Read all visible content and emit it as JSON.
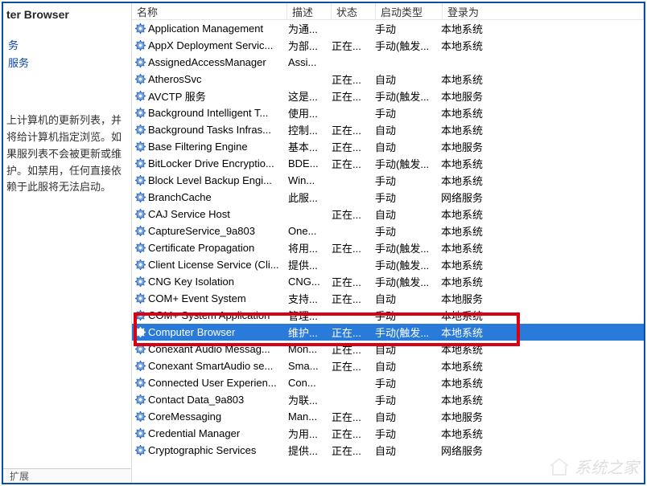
{
  "sidebar": {
    "title_partial": "ter Browser",
    "link1": "务",
    "link2": "服务",
    "desc_partial": "上计算机的更新列表，并将给计算机指定浏览。如果服列表不会被更新或维护。如禁用，任何直接依赖于此服将无法启动。"
  },
  "columns": {
    "name": "名称",
    "description": "描述",
    "status": "状态",
    "startup": "启动类型",
    "logon": "登录为"
  },
  "rows": [
    {
      "name": "Application Management",
      "desc": "为通...",
      "status": "",
      "startup": "手动",
      "logon": "本地系统"
    },
    {
      "name": "AppX Deployment Servic...",
      "desc": "为部...",
      "status": "正在...",
      "startup": "手动(触发...",
      "logon": "本地系统"
    },
    {
      "name": "AssignedAccessManager",
      "desc": "Assi...",
      "status": "",
      "startup": "",
      "logon": ""
    },
    {
      "name": "AtherosSvc",
      "desc": "",
      "status": "正在...",
      "startup": "自动",
      "logon": "本地系统"
    },
    {
      "name": "AVCTP 服务",
      "desc": "这是...",
      "status": "正在...",
      "startup": "手动(触发...",
      "logon": "本地服务"
    },
    {
      "name": "Background Intelligent T...",
      "desc": "使用...",
      "status": "",
      "startup": "手动",
      "logon": "本地系统"
    },
    {
      "name": "Background Tasks Infras...",
      "desc": "控制...",
      "status": "正在...",
      "startup": "自动",
      "logon": "本地系统"
    },
    {
      "name": "Base Filtering Engine",
      "desc": "基本...",
      "status": "正在...",
      "startup": "自动",
      "logon": "本地服务"
    },
    {
      "name": "BitLocker Drive Encryptio...",
      "desc": "BDE...",
      "status": "正在...",
      "startup": "手动(触发...",
      "logon": "本地系统"
    },
    {
      "name": "Block Level Backup Engi...",
      "desc": "Win...",
      "status": "",
      "startup": "手动",
      "logon": "本地系统"
    },
    {
      "name": "BranchCache",
      "desc": "此服...",
      "status": "",
      "startup": "手动",
      "logon": "网络服务"
    },
    {
      "name": "CAJ Service Host",
      "desc": "",
      "status": "正在...",
      "startup": "自动",
      "logon": "本地系统"
    },
    {
      "name": "CaptureService_9a803",
      "desc": "One...",
      "status": "",
      "startup": "手动",
      "logon": "本地系统"
    },
    {
      "name": "Certificate Propagation",
      "desc": "将用...",
      "status": "正在...",
      "startup": "手动(触发...",
      "logon": "本地系统"
    },
    {
      "name": "Client License Service (Cli...",
      "desc": "提供...",
      "status": "",
      "startup": "手动(触发...",
      "logon": "本地系统"
    },
    {
      "name": "CNG Key Isolation",
      "desc": "CNG...",
      "status": "正在...",
      "startup": "手动(触发...",
      "logon": "本地系统"
    },
    {
      "name": "COM+ Event System",
      "desc": "支持...",
      "status": "正在...",
      "startup": "自动",
      "logon": "本地服务"
    },
    {
      "name": "COM+ System Application",
      "desc": "管理...",
      "status": "",
      "startup": "手动",
      "logon": "本地系统"
    },
    {
      "name": "Computer Browser",
      "desc": "维护...",
      "status": "正在...",
      "startup": "手动(触发...",
      "logon": "本地系统",
      "selected": true
    },
    {
      "name": "Conexant Audio Messag...",
      "desc": "Mon...",
      "status": "正在...",
      "startup": "自动",
      "logon": "本地系统"
    },
    {
      "name": "Conexant SmartAudio se...",
      "desc": "Sma...",
      "status": "正在...",
      "startup": "自动",
      "logon": "本地系统"
    },
    {
      "name": "Connected User Experien...",
      "desc": "Con...",
      "status": "",
      "startup": "手动",
      "logon": "本地系统"
    },
    {
      "name": "Contact Data_9a803",
      "desc": "为联...",
      "status": "",
      "startup": "手动",
      "logon": "本地系统"
    },
    {
      "name": "CoreMessaging",
      "desc": "Man...",
      "status": "正在...",
      "startup": "自动",
      "logon": "本地服务"
    },
    {
      "name": "Credential Manager",
      "desc": "为用...",
      "status": "正在...",
      "startup": "手动",
      "logon": "本地系统"
    },
    {
      "name": "Cryptographic Services",
      "desc": "提供...",
      "status": "正在...",
      "startup": "自动",
      "logon": "网络服务"
    }
  ],
  "tab": "扩展 ",
  "watermark": "系统之家"
}
